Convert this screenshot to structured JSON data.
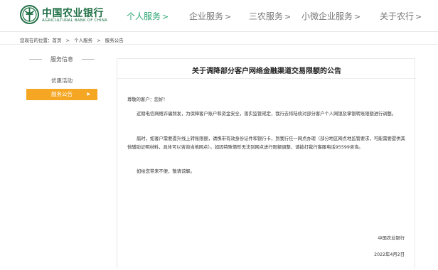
{
  "brand": {
    "name_cn": "中国农业银行",
    "name_en": "AGRICULTURAL BANK OF CHINA",
    "color": "#1f6f45"
  },
  "nav": {
    "items": [
      {
        "label": "个人服务",
        "chevron": ">",
        "active": true
      },
      {
        "label": "企业服务",
        "chevron": ">",
        "active": false
      },
      {
        "label": "三农服务",
        "chevron": ">",
        "active": false
      },
      {
        "label": "小微企业服务",
        "chevron": ">",
        "active": false
      },
      {
        "label": "关于农行",
        "chevron": ">",
        "active": false
      }
    ],
    "active_color": "#2ba673"
  },
  "breadcrumb": {
    "prefix": "您现在的位置：首页",
    "sep": ">",
    "items": [
      "个人服务",
      "服务公告"
    ]
  },
  "sidebar": {
    "title": "服务信息",
    "items": [
      {
        "label": "优惠活动",
        "active": false
      },
      {
        "label": "服务公告",
        "active": true,
        "arrow": "▶"
      }
    ],
    "active_color": "#f5a623"
  },
  "notice": {
    "title": "关于调降部分客户网络金融渠道交易限额的公告",
    "greeting": "尊敬的客户：您好！",
    "para1": "近期电信网络诈骗频发，为保障客户账户和资金安全，落实监管规定，我行去将陆续对部分客户个人网银及掌银转账限额进行调整。",
    "para2": "届时，如客户需要提升线上转账限额，请携带有效身份证件和银行卡，到我行任一网点办理（部分地区网点地监管要求，可能需要提供其他辅助证明材料，具体可以咨询当地网点）。如因特殊情形无法到网点进行限额调整，请拨打我行客服电话95599咨询。",
    "para3": "如给您带来不便，敬请谅解。",
    "signature": "中国农业银行",
    "date": "2022年4月2日"
  }
}
